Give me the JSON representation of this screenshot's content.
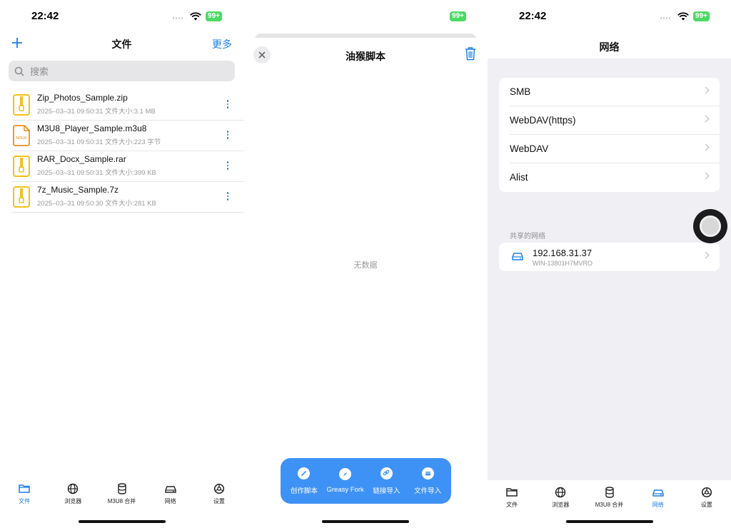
{
  "colors": {
    "accent": "#1a7de8",
    "battery": "#4cd964",
    "action_bar": "#3f92f5"
  },
  "status": {
    "time": "22:42",
    "battery": "99+"
  },
  "files_screen": {
    "title": "文件",
    "add_icon": "plus-icon",
    "more_label": "更多",
    "search_placeholder": "搜索",
    "files": [
      {
        "name": "Zip_Photos_Sample.zip",
        "meta": "2025–03–31 09:50:31 文件大小:3.1 MB",
        "icon": "zip-file-icon"
      },
      {
        "name": "M3U8_Player_Sample.m3u8",
        "meta": "2025–03–31 09:50:31 文件大小:223 字节",
        "icon": "m3u8-file-icon",
        "icon_text": "M3U8"
      },
      {
        "name": "RAR_Docx_Sample.rar",
        "meta": "2025–03–31 09:50:31 文件大小:399 KB",
        "icon": "zip-file-icon"
      },
      {
        "name": "7z_Music_Sample.7z",
        "meta": "2025–03–31 09:50:30 文件大小:281 KB",
        "icon": "zip-file-icon"
      }
    ]
  },
  "tabs": [
    {
      "label": "文件",
      "icon": "folder-icon"
    },
    {
      "label": "浏览器",
      "icon": "globe-icon"
    },
    {
      "label": "M3U8 合并",
      "icon": "database-icon"
    },
    {
      "label": "网络",
      "icon": "network-drive-icon"
    },
    {
      "label": "设置",
      "icon": "settings-icon"
    }
  ],
  "script_sheet": {
    "title": "油猴脚本",
    "empty_text": "无数据",
    "actions": [
      {
        "label": "创作脚本",
        "icon": "pencil-icon"
      },
      {
        "label": "Greasy Fork",
        "icon": "compass-icon"
      },
      {
        "label": "链接导入",
        "icon": "link-icon"
      },
      {
        "label": "文件导入",
        "icon": "file-import-icon"
      }
    ]
  },
  "network_screen": {
    "title": "网络",
    "protocols": [
      "SMB",
      "WebDAV(https)",
      "WebDAV",
      "Alist"
    ],
    "shared_section_label": "共享的网络",
    "shared": {
      "ip": "192.168.31.37",
      "host": "WIN-13801H7MVRO"
    }
  }
}
